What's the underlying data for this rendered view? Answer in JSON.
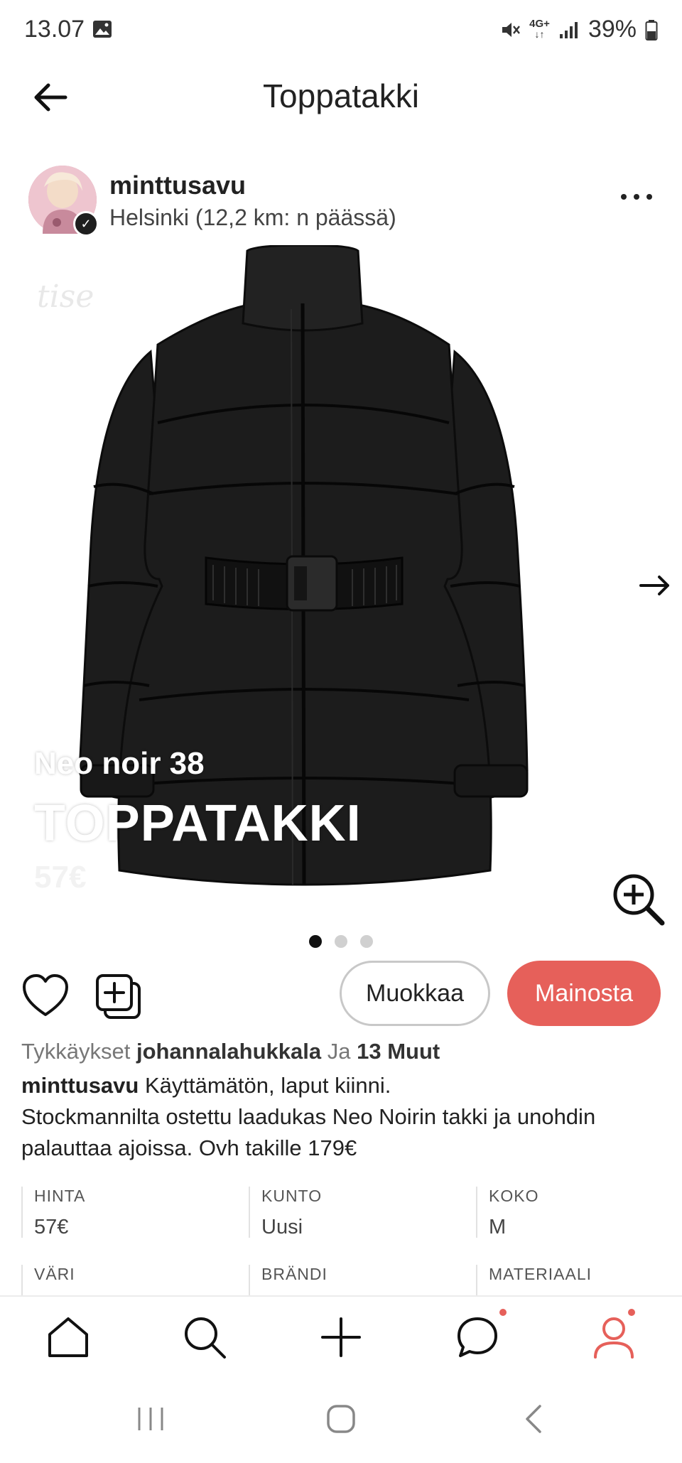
{
  "status_bar": {
    "time": "13.07",
    "network": "4G+",
    "battery": "39%",
    "icons": [
      "gallery-icon",
      "mute-icon",
      "network-icon",
      "signal-icon",
      "battery-icon"
    ]
  },
  "header": {
    "title": "Toppatakki",
    "back_icon": "arrow-left-icon"
  },
  "seller": {
    "name": "minttusavu",
    "location": "Helsinki (12,2 km: n päässä)",
    "verified_icon": "✓"
  },
  "image": {
    "watermark": "tise",
    "overlay_brand": "Neo noir 38",
    "overlay_title": "TOPPATAKKI",
    "overlay_price": "57€",
    "page_count": 3,
    "active_page": 1
  },
  "actions": {
    "edit_label": "Muokkaa",
    "promote_label": "Mainosta",
    "accent_color": "#e6605a"
  },
  "likes": {
    "prefix": "Tykkäykset",
    "user": "johannalahukkala",
    "conjunction": "Ja",
    "others": "13 Muut"
  },
  "description": {
    "author": "minttusavu",
    "line1": "Käyttämätön, laput kiinni.",
    "line2": "Stockmannilta ostettu laadukas Neo Noirin takki ja unohdin palauttaa ajoissa. Ovh takille 179€"
  },
  "specs": [
    {
      "label": "HINTA",
      "value": "57€"
    },
    {
      "label": "KUNTO",
      "value": "Uusi"
    },
    {
      "label": "KOKO",
      "value": "M"
    },
    {
      "label": "VÄRI",
      "value": ""
    },
    {
      "label": "BRÄNDI",
      "value": ""
    },
    {
      "label": "MATERIAALI",
      "value": ""
    }
  ],
  "bottom_nav": [
    "home-icon",
    "search-icon",
    "add-icon",
    "chat-icon",
    "profile-icon"
  ]
}
